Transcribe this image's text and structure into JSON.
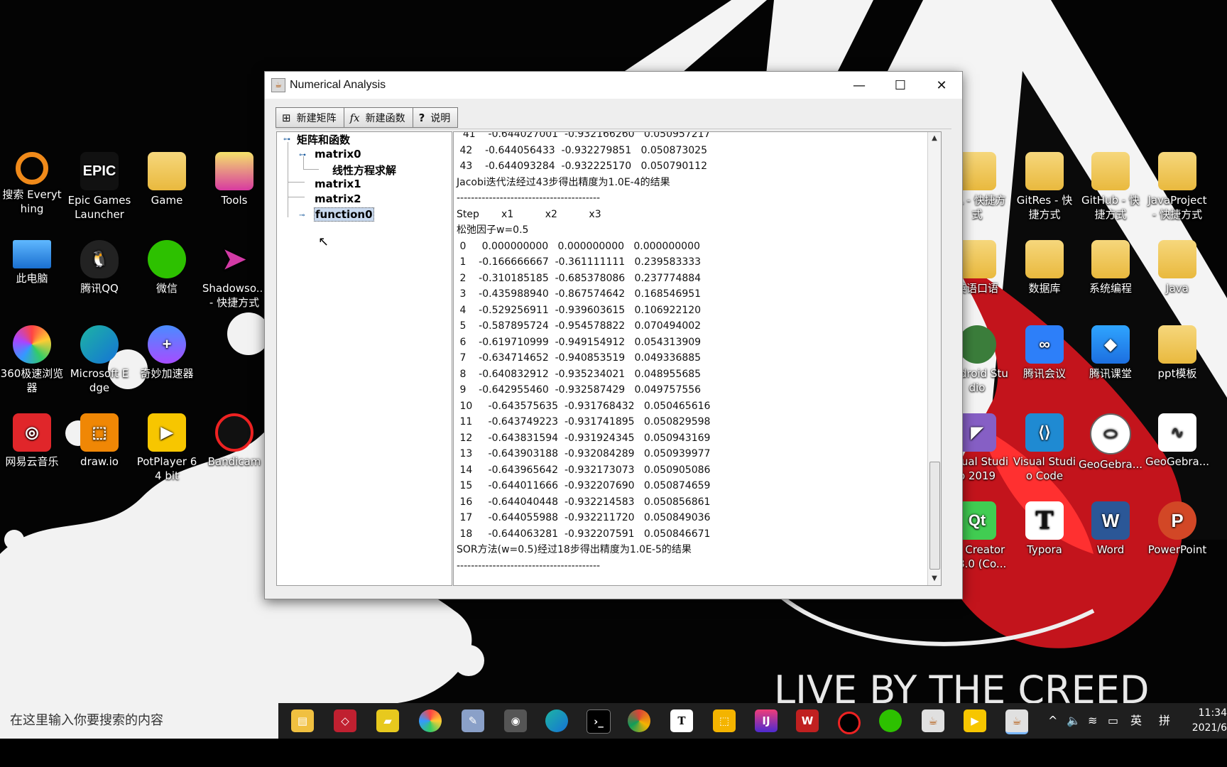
{
  "window": {
    "title": "Numerical Analysis",
    "toolbar": [
      {
        "label": "新建矩阵",
        "icon": "grid-icon"
      },
      {
        "label": "新建函数",
        "icon": "fx-icon"
      },
      {
        "label": "说明",
        "icon": "question-icon"
      }
    ],
    "tree": {
      "root": "矩阵和函数",
      "matrix0": "matrix0",
      "child": "线性方程求解",
      "matrix1": "matrix1",
      "matrix2": "matrix2",
      "function0": "function0"
    },
    "output_lines": [
      "  41    -0.644027001  -0.932166260   0.050957217",
      " 42    -0.644056433  -0.932279851   0.050873025",
      " 43    -0.644093284  -0.932225170   0.050790112",
      "Jacobi迭代法经过43步得出精度为1.0E-4的结果",
      "----------------------------------------",
      "Step       x1          x2          x3",
      "松弛因子w=0.5",
      " 0     0.000000000   0.000000000   0.000000000",
      " 1    -0.166666667  -0.361111111   0.239583333",
      " 2    -0.310185185  -0.685378086   0.237774884",
      " 3    -0.435988940  -0.867574642   0.168546951",
      " 4    -0.529256911  -0.939603615   0.106922120",
      " 5    -0.587895724  -0.954578822   0.070494002",
      " 6    -0.619710999  -0.949154912   0.054313909",
      " 7    -0.634714652  -0.940853519   0.049336885",
      " 8    -0.640832912  -0.935234021   0.048955685",
      " 9    -0.642955460  -0.932587429   0.049757556",
      " 10     -0.643575635  -0.931768432   0.050465616",
      " 11     -0.643749223  -0.931741895   0.050829598",
      " 12     -0.643831594  -0.931924345   0.050943169",
      " 13     -0.643903188  -0.932084289   0.050939977",
      " 14     -0.643965642  -0.932173073   0.050905086",
      " 15     -0.644011666  -0.932207690   0.050874659",
      " 16     -0.644040448  -0.932214583   0.050856861",
      " 17     -0.644055988  -0.932211720   0.050849036",
      " 18     -0.644063281  -0.932207591   0.050846671",
      "SOR方法(w=0.5)经过18步得出精度为1.0E-5的结果",
      "----------------------------------------"
    ]
  },
  "desktop_icons": {
    "col1": [
      "搜索 Everything",
      "此电脑",
      "360极速浏览器",
      "网易云音乐"
    ],
    "col2": [
      "Epic Games Launcher",
      "腾讯QQ",
      "Microsoft Edge",
      "draw.io"
    ],
    "col3": [
      "Game",
      "微信",
      "奇妙加速器",
      "PotPlayer 64 bit"
    ],
    "col4": [
      "Tools",
      "Shadowso... - 快捷方式",
      "Bandicam"
    ],
    "right1": [
      "ML - 快捷方式",
      "GitRes - 快捷方式",
      "GitHub - 快捷方式",
      "JavaProject - 快捷方式"
    ],
    "right2": [
      "英语口语",
      "数据库",
      "系统编程",
      "Java"
    ],
    "right3": [
      "Android Studio",
      "腾讯会议",
      "腾讯课堂",
      "ppt模板"
    ],
    "right4": [
      "Visual Studio 2019",
      "Visual Studio Code",
      "GeoGebra...",
      "GeoGebra..."
    ],
    "right5": [
      "Qt Creator 4.8.0 (Co...",
      "Typora",
      "Word",
      "PowerPoint"
    ]
  },
  "wallpaper_text": "LIVE BY THE CREED",
  "taskbar": {
    "search_placeholder": "在这里输入你要搜索的内容",
    "tray_input": "英",
    "tray_ime": "拼",
    "time": "11:34",
    "date": "2021/6"
  }
}
